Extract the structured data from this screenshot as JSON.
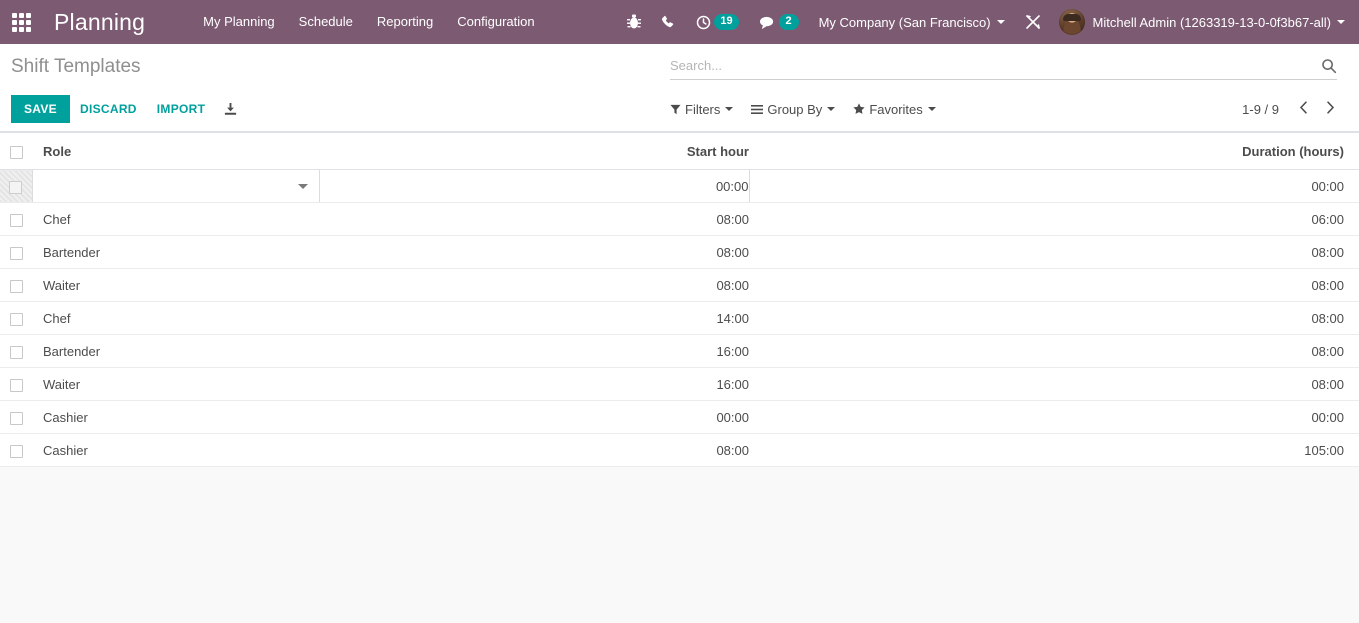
{
  "navbar": {
    "apps_icon": "apps-grid-icon",
    "brand": "Planning",
    "menus": [
      {
        "label": "My Planning"
      },
      {
        "label": "Schedule"
      },
      {
        "label": "Reporting"
      },
      {
        "label": "Configuration"
      }
    ],
    "system_icons": [
      {
        "name": "bug-icon",
        "badge": null
      },
      {
        "name": "phone-icon",
        "badge": null
      },
      {
        "name": "activity-clock-icon",
        "badge": "19"
      },
      {
        "name": "messages-icon",
        "badge": "2"
      }
    ],
    "company": "My Company (San Francisco)",
    "debug_icon": "wrench-tools-icon",
    "user": "Mitchell Admin (1263319-13-0-0f3b67-all)",
    "accent": "#00a09d",
    "background": "#7c5a72"
  },
  "control_panel": {
    "title": "Shift Templates",
    "save_label": "SAVE",
    "discard_label": "DISCARD",
    "import_label": "IMPORT",
    "download_icon": "download-icon",
    "search": {
      "value": "",
      "placeholder": "Search...",
      "icon": "search-icon"
    },
    "filters": [
      {
        "label": "Filters",
        "icon": "funnel-icon"
      },
      {
        "label": "Group By",
        "icon": "bars-icon"
      },
      {
        "label": "Favorites",
        "icon": "star-icon"
      }
    ],
    "pager": {
      "range": "1-9 / 9",
      "prev_icon": "chevron-left-icon",
      "next_icon": "chevron-right-icon"
    }
  },
  "table": {
    "columns": [
      "Role",
      "Start hour",
      "Duration (hours)"
    ],
    "edit_row": {
      "role": "",
      "start_hour": "00:00",
      "duration": "00:00"
    },
    "rows": [
      {
        "role": "Chef",
        "start_hour": "08:00",
        "duration": "06:00"
      },
      {
        "role": "Bartender",
        "start_hour": "08:00",
        "duration": "08:00"
      },
      {
        "role": "Waiter",
        "start_hour": "08:00",
        "duration": "08:00"
      },
      {
        "role": "Chef",
        "start_hour": "14:00",
        "duration": "08:00"
      },
      {
        "role": "Bartender",
        "start_hour": "16:00",
        "duration": "08:00"
      },
      {
        "role": "Waiter",
        "start_hour": "16:00",
        "duration": "08:00"
      },
      {
        "role": "Cashier",
        "start_hour": "00:00",
        "duration": "00:00"
      },
      {
        "role": "Cashier",
        "start_hour": "08:00",
        "duration": "105:00"
      }
    ]
  }
}
